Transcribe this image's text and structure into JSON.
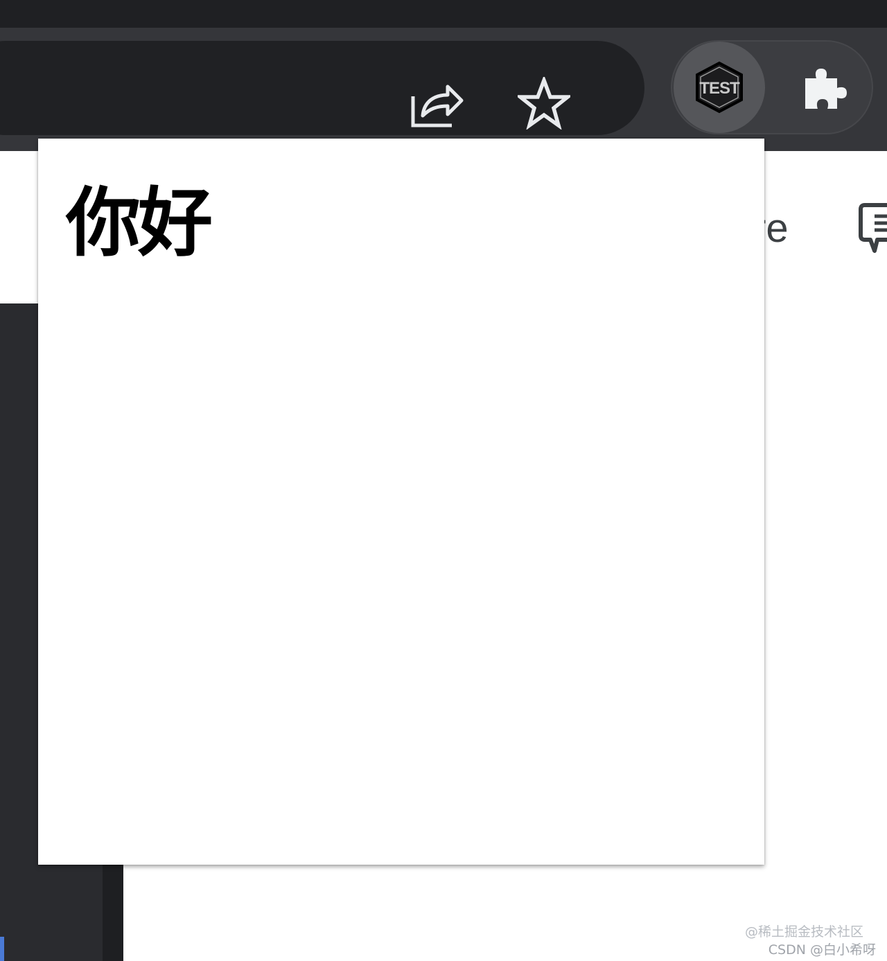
{
  "browser": {
    "toolbar": {
      "share_icon": "share-arrow-icon",
      "bookmark_icon": "star-outline-icon"
    },
    "extensions": {
      "active_extension_badge": "TEST",
      "active_extension_icon": "test-hexagon-icon",
      "extensions_menu_icon": "puzzle-piece-icon"
    },
    "colors": {
      "tabstrip": "#1f2023",
      "toolbar": "#35363a",
      "omnibox": "#202124",
      "icon": "#e8eaed"
    }
  },
  "background_page": {
    "partial_text": "re",
    "feedback_icon": "feedback-bubble-icon"
  },
  "popup": {
    "heading": "你好"
  },
  "watermarks": {
    "line1": "@稀土掘金技术社区",
    "line2": "CSDN @白小希呀"
  }
}
